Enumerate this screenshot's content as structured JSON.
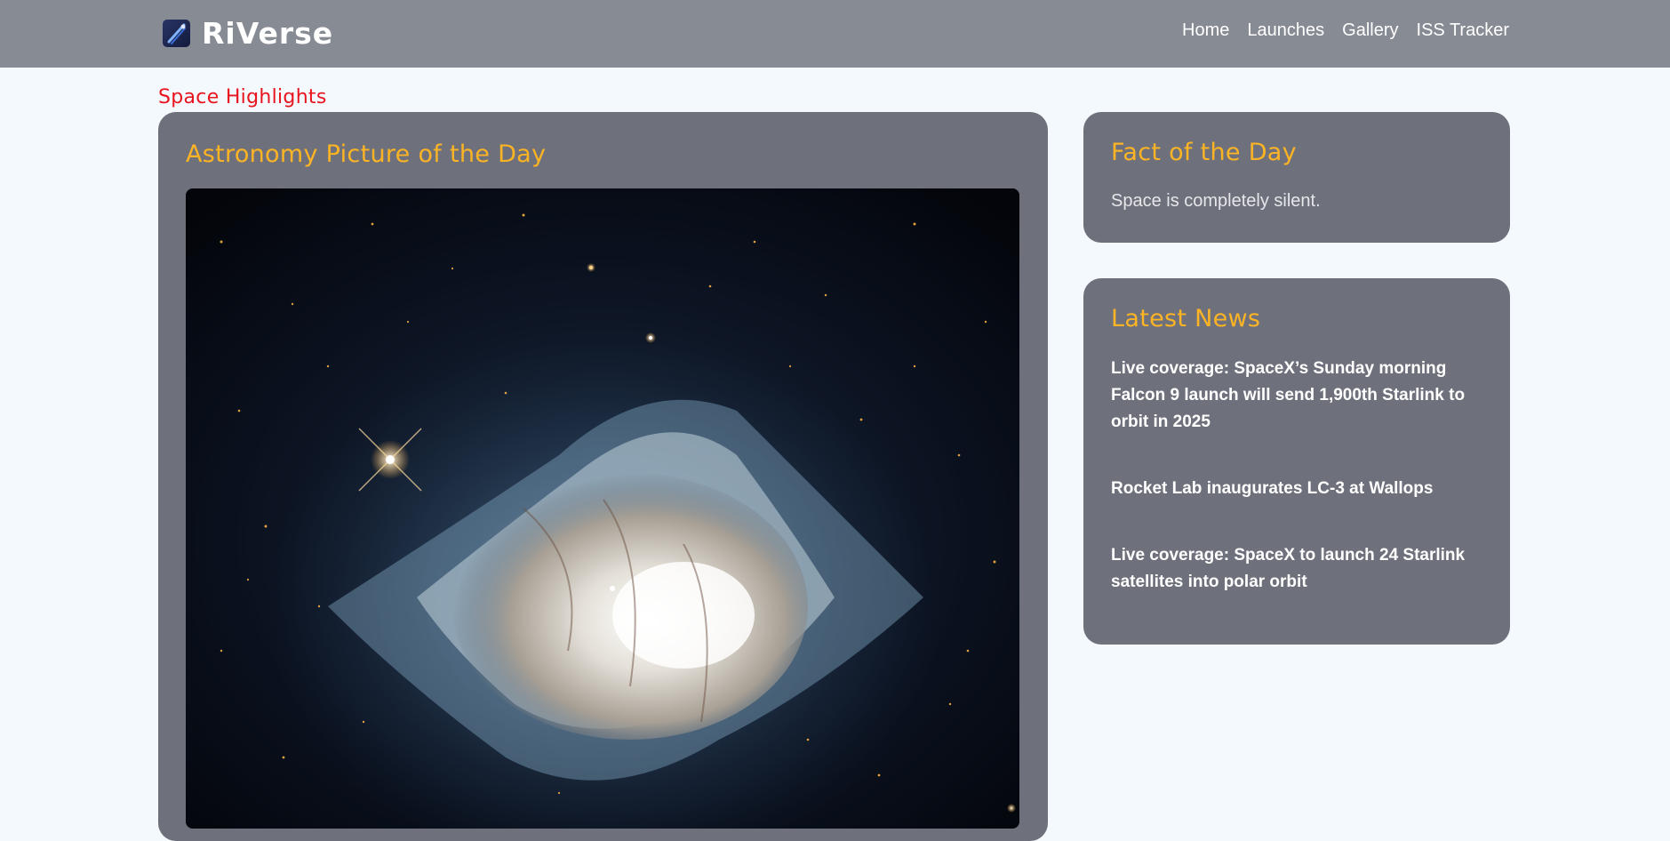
{
  "brand": {
    "name": "RiVerse",
    "logo_icon": "rocket-icon"
  },
  "nav": {
    "items": [
      "Home",
      "Launches",
      "Gallery",
      "ISS Tracker"
    ]
  },
  "section": {
    "title": "Space Highlights"
  },
  "apod": {
    "title": "Astronomy Picture of the Day"
  },
  "fact": {
    "title": "Fact of the Day",
    "text": "Space is completely silent."
  },
  "news": {
    "title": "Latest News",
    "items": [
      "Live coverage: SpaceX’s Sunday morning Falcon 9 launch will send 1,900th Starlink to orbit in 2025",
      "Rocket Lab inaugurates LC-3 at Wallops",
      "Live coverage: SpaceX to launch 24 Starlink satellites into polar orbit"
    ]
  },
  "colors": {
    "navbar": "#878b94",
    "page_bg": "#f4f9fd",
    "card_bg": "#6e717b",
    "accent": "#fcb424",
    "section_title": "#e8141e"
  }
}
